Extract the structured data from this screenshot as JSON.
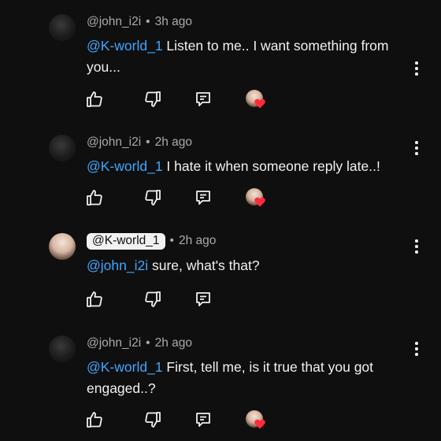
{
  "comments": [
    {
      "author": "@john_i2i",
      "time": "3h ago",
      "mention": "@K-world_1",
      "text": " Listen to me.. I want something from you...",
      "avatar": "dark-avatar",
      "creator_heart": true
    },
    {
      "author": "@john_i2i",
      "time": "2h ago",
      "mention": "@K-world_1",
      "text": " I hate it when someone reply late..!",
      "avatar": "dark-avatar",
      "creator_heart": true
    },
    {
      "author": "@K-world_1",
      "time": "2h ago",
      "mention": "@john_i2i",
      "text": " sure, what's that?",
      "avatar": "light-avatar",
      "creator_badge": true,
      "creator_heart": false
    },
    {
      "author": "@john_i2i",
      "time": "2h ago",
      "mention": "@K-world_1",
      "text": " First, tell me, is it true that you got engaged..?",
      "avatar": "dark-avatar",
      "creator_heart": true
    }
  ],
  "separator": "•",
  "icons": {
    "like": "thumbs-up-icon",
    "dislike": "thumbs-down-icon",
    "reply": "reply-icon",
    "more": "more-vertical-icon",
    "heart": "heart-icon"
  },
  "colors": {
    "background": "#0f0f0f",
    "text": "#f1f1f1",
    "meta": "#aaaaaa",
    "mention": "#3ea6ff",
    "heart": "#ff2b3d"
  }
}
